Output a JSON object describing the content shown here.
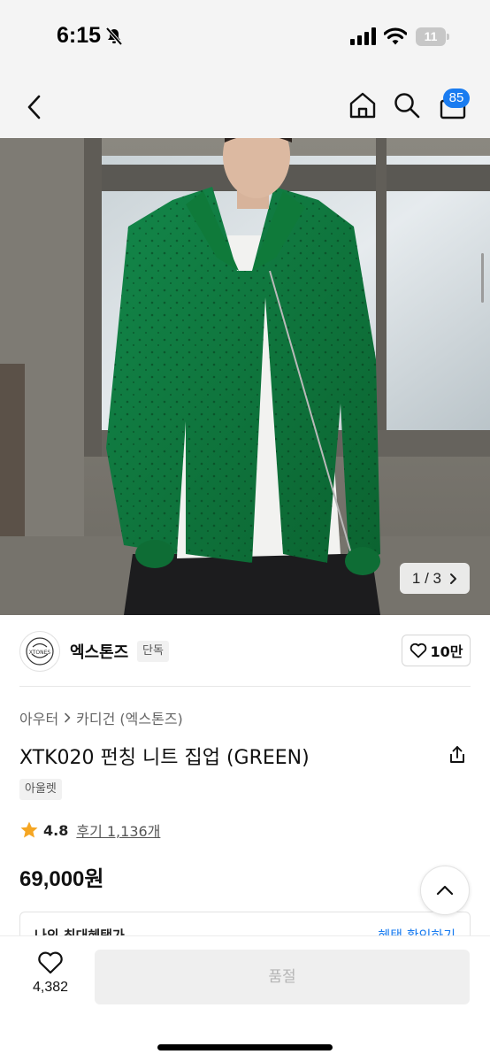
{
  "status_bar": {
    "time": "6:15",
    "battery": "11"
  },
  "header": {
    "cart_count": "85"
  },
  "gallery": {
    "counter": "1 / 3"
  },
  "brand": {
    "name": "엑스톤즈",
    "tag": "단독",
    "logo_text": "XTONES",
    "likes": "10만"
  },
  "product": {
    "breadcrumb": [
      "아우터",
      "카디건 (엑스톤즈)"
    ],
    "title": "XTK020 펀칭 니트 집업 (GREEN)",
    "tag": "아울렛",
    "rating": "4.8",
    "reviews": "후기 1,136개",
    "price": "69,000원"
  },
  "coupon": {
    "label": "나의 최대혜택가",
    "link": "혜택 확인하기"
  },
  "bottom_bar": {
    "wish_count": "4,382",
    "buy_label": "품절"
  },
  "colors": {
    "accent": "#1a7cf0",
    "knit_green": "#0f7a3a",
    "star": "#f5a623"
  }
}
